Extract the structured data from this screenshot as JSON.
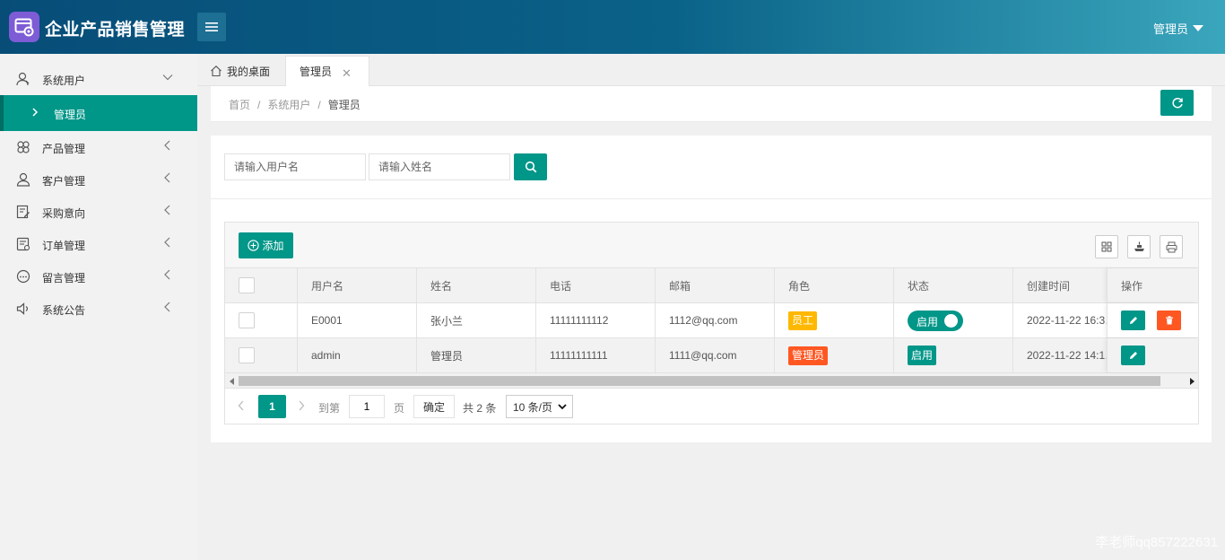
{
  "header": {
    "app_title": "企业产品销售管理",
    "user_label": "管理员",
    "logo_icon": "app-logo-icon",
    "menu_icon": "hamburger-icon"
  },
  "sidebar": {
    "items": [
      {
        "label": "系统用户",
        "icon": "user-icon",
        "expanded": true
      },
      {
        "label": "产品管理",
        "icon": "clover-icon"
      },
      {
        "label": "客户管理",
        "icon": "person-icon"
      },
      {
        "label": "采购意向",
        "icon": "edit-doc-icon"
      },
      {
        "label": "订单管理",
        "icon": "order-icon"
      },
      {
        "label": "留言管理",
        "icon": "message-icon"
      },
      {
        "label": "系统公告",
        "icon": "speaker-icon"
      }
    ],
    "sub_item": {
      "label": "管理员"
    }
  },
  "tabs": {
    "home_label": "我的桌面",
    "active_label": "管理员",
    "close_glyph": "✕"
  },
  "breadcrumb": {
    "items": [
      "首页",
      "系统用户",
      "管理员"
    ],
    "separator": "/"
  },
  "search": {
    "username_placeholder": "请输入用户名",
    "name_placeholder": "请输入姓名"
  },
  "toolbar": {
    "add_label": "添加"
  },
  "table": {
    "columns": [
      "用户名",
      "姓名",
      "电话",
      "邮箱",
      "角色",
      "状态",
      "创建时间",
      "操作"
    ],
    "rows": [
      {
        "username": "E0001",
        "name": "张小兰",
        "phone": "11111111112",
        "email": "1112@qq.com",
        "role": "员工",
        "status": "启用",
        "created": "2022-11-22 16:3…"
      },
      {
        "username": "admin",
        "name": "管理员",
        "phone": "11111111111",
        "email": "1111@qq.com",
        "role": "管理员",
        "status": "启用",
        "created": "2022-11-22 14:1…"
      }
    ]
  },
  "pager": {
    "current": "1",
    "goto_label": "到第",
    "page_input": "1",
    "page_unit": "页",
    "confirm_label": "确定",
    "total_label": "共 2 条",
    "page_size": "10 条/页"
  },
  "watermark": "李老师qq857222631",
  "colors": {
    "primary": "#009688",
    "header_start": "#074d78",
    "header_end": "#3aa6bc",
    "badge_yellow": "#ffb800",
    "badge_red": "#ff5722"
  }
}
